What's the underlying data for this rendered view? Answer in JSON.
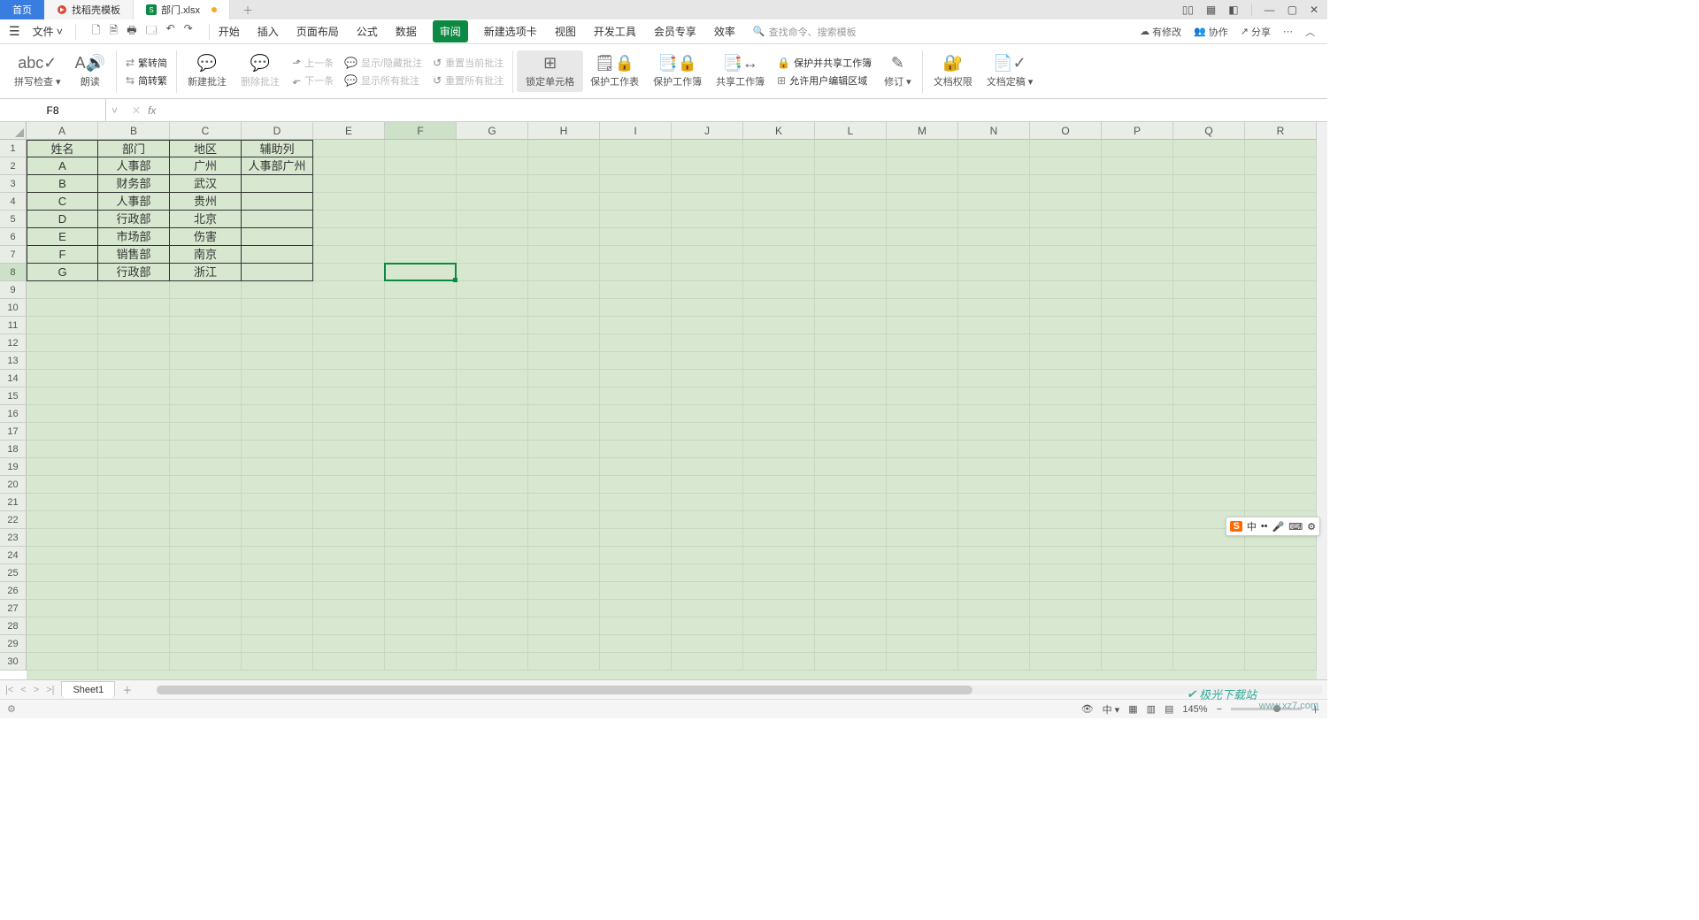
{
  "tabs": {
    "home": "首页",
    "template": "找稻壳模板",
    "file": "部门.xlsx"
  },
  "fileMenu": "文件",
  "menuTabs": [
    "开始",
    "插入",
    "页面布局",
    "公式",
    "数据",
    "审阅",
    "新建选项卡",
    "视图",
    "开发工具",
    "会员专享",
    "效率"
  ],
  "activeMenuTab": "审阅",
  "searchPlaceholder": "查找命令、搜索模板",
  "topRight": {
    "changes": "有修改",
    "coop": "协作",
    "share": "分享"
  },
  "ribbon": {
    "spellcheck": "拼写检查",
    "read": "朗读",
    "toSimplified": "繁转简",
    "toTraditional": "简转繁",
    "newComment": "新建批注",
    "delComment": "删除批注",
    "prev": "上一条",
    "next": "下一条",
    "showHide": "显示/隐藏批注",
    "showAll": "显示所有批注",
    "resetCur": "重置当前批注",
    "resetAll": "重置所有批注",
    "lockCell": "锁定单元格",
    "protectSheet": "保护工作表",
    "protectBook": "保护工作簿",
    "shareBook": "共享工作簿",
    "protectShare": "保护并共享工作簿",
    "allowEdit": "允许用户编辑区域",
    "track": "修订",
    "docPerm": "文档权限",
    "docFinal": "文档定稿"
  },
  "nameBox": "F8",
  "columns": [
    "A",
    "B",
    "C",
    "D",
    "E",
    "F",
    "G",
    "H",
    "I",
    "J",
    "K",
    "L",
    "M",
    "N",
    "O",
    "P",
    "Q",
    "R"
  ],
  "rows": 30,
  "activeCol": "F",
  "activeRow": 8,
  "tableData": [
    [
      "姓名",
      "部门",
      "地区",
      "辅助列"
    ],
    [
      "A",
      "人事部",
      "广州",
      "人事部广州"
    ],
    [
      "B",
      "财务部",
      "武汉",
      ""
    ],
    [
      "C",
      "人事部",
      "贵州",
      ""
    ],
    [
      "D",
      "行政部",
      "北京",
      ""
    ],
    [
      "E",
      "市场部",
      "伤害",
      ""
    ],
    [
      "F",
      "销售部",
      "南京",
      ""
    ],
    [
      "G",
      "行政部",
      "浙江",
      ""
    ]
  ],
  "sheetName": "Sheet1",
  "zoom": "145%",
  "ime": "中",
  "watermark_site": "极光下载站",
  "watermark_url": "www.xz7.com"
}
